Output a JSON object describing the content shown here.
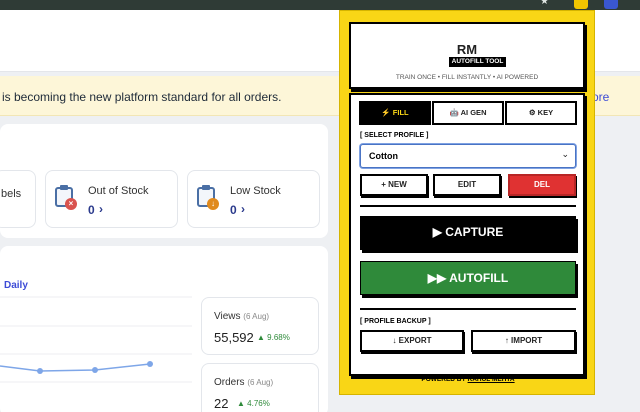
{
  "browser": {
    "star_icon": "star-icon",
    "extension_icons": [
      "puzzle-icon",
      "profile-icon"
    ]
  },
  "page": {
    "banner_text": "is becoming the new platform standard for all orders.",
    "banner_link": "ore",
    "cards": [
      {
        "title": "bels",
        "value": ""
      },
      {
        "title": "Out of Stock",
        "value": "0",
        "arrow": "›",
        "badge_color": "#d9534f"
      },
      {
        "title": "Low Stock",
        "value": "0",
        "arrow": "›",
        "badge_color": "#e08a1e"
      }
    ],
    "chart_tab": "Daily",
    "stats": [
      {
        "label": "Views",
        "date": "(6 Aug)",
        "value": "55,592",
        "delta": "▲ 9.68%"
      },
      {
        "label": "Orders",
        "date": "(6 Aug)",
        "value": "22",
        "delta": "▲ 4.76%"
      }
    ]
  },
  "popup": {
    "title": "RM",
    "tag": "AUTOFILL TOOL",
    "subtitle": "TRAIN ONCE • FILL INSTANTLY • AI POWERED",
    "tabs": [
      {
        "label": "⚡ FILL",
        "active": true
      },
      {
        "label": "🤖 AI GEN",
        "active": false
      },
      {
        "label": "⚙ KEY",
        "active": false
      }
    ],
    "select_profile_label": "[ SELECT PROFILE ]",
    "selected_profile": "Cotton",
    "profile_buttons": {
      "new": "+ NEW",
      "edit": "EDIT",
      "del": "DEL"
    },
    "capture_label": "▶ CAPTURE",
    "autofill_label": "▶▶ AUTOFILL",
    "backup_label": "[ PROFILE BACKUP ]",
    "export_label": "↓ EXPORT",
    "import_label": "↑ IMPORT",
    "footer_prefix": "POWERED BY",
    "footer_author": "RAHUL MEHTA",
    "colors": {
      "accent": "#f9d616",
      "autofill": "#2f8a3a",
      "delete": "#e03232"
    }
  }
}
